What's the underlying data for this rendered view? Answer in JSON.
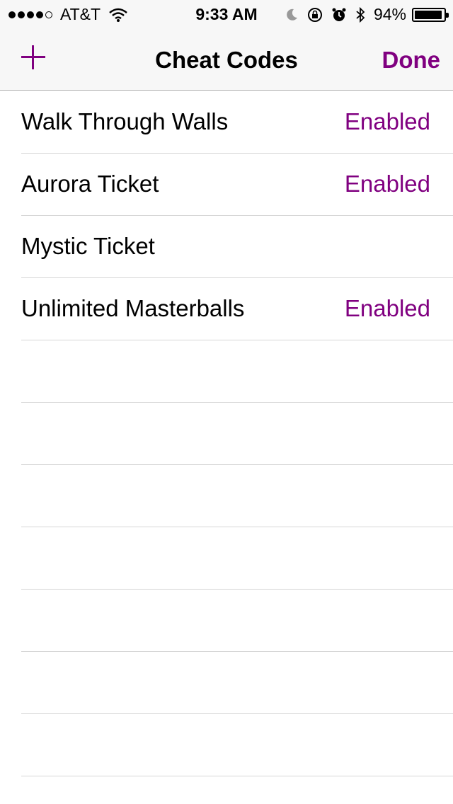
{
  "status_bar": {
    "carrier": "AT&T",
    "time": "9:33 AM",
    "battery": "94%",
    "battery_level": 0.94,
    "signal_bars_filled": 4,
    "signal_bars_total": 5,
    "icons": [
      "wifi-icon",
      "moon-icon",
      "rotation-lock-icon",
      "alarm-icon",
      "bluetooth-icon",
      "battery-icon"
    ]
  },
  "navbar": {
    "title": "Cheat Codes",
    "add_label": "+",
    "done_label": "Done"
  },
  "colors": {
    "accent": "#800080",
    "navbar_bg": "#f7f7f7",
    "separator": "#d6d6d6"
  },
  "cheats": [
    {
      "name": "Walk Through Walls",
      "status": "Enabled"
    },
    {
      "name": "Aurora Ticket",
      "status": "Enabled"
    },
    {
      "name": "Mystic Ticket",
      "status": ""
    },
    {
      "name": "Unlimited Masterballs",
      "status": "Enabled"
    }
  ]
}
